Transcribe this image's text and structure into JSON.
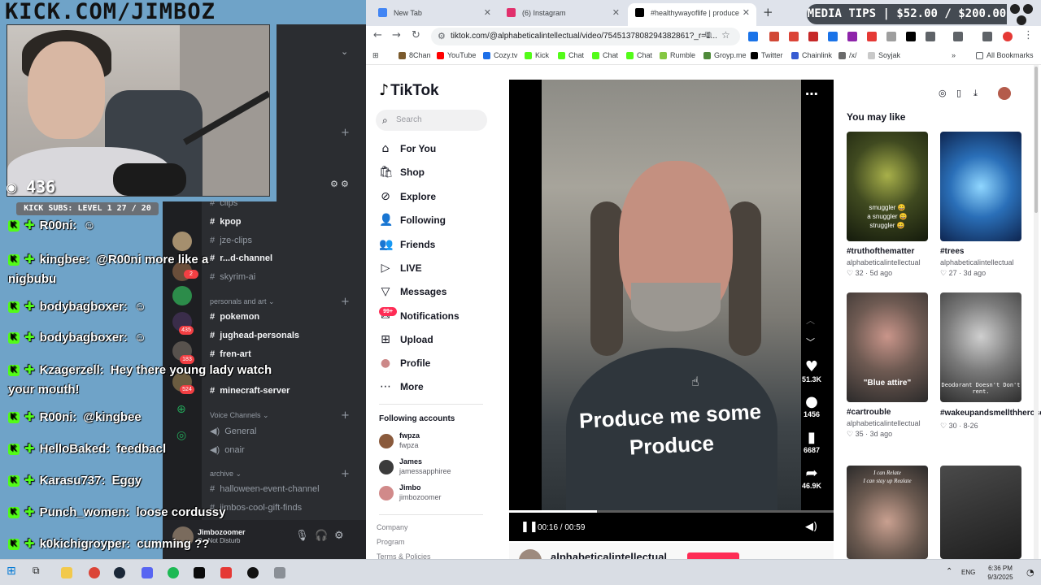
{
  "overlay": {
    "banner": "KICK.COM/JIMBOZ",
    "sub_count": "436",
    "kick_subs": "KICK SUBS: LEVEL 1 27 / 20",
    "chat": [
      {
        "user": "R00ni:",
        "msg": ""
      },
      {
        "user": "kingbee:",
        "msg": "@R00ni more like a nigbubu"
      },
      {
        "user": "bodybagboxer:",
        "msg": ""
      },
      {
        "user": "bodybagboxer:",
        "msg": ""
      },
      {
        "user": "Kzagerzell:",
        "msg": "Hey there young lady watch your mouth!"
      },
      {
        "user": "R00ni:",
        "msg": "@kingbee"
      },
      {
        "user": "HelloBaked:",
        "msg": "feedbacl"
      },
      {
        "user": "Karasu737:",
        "msg": "Eggy"
      },
      {
        "user": "Punch_women:",
        "msg": "loose cordussy"
      },
      {
        "user": "k0kichigroyper:",
        "msg": "cumming ??"
      }
    ]
  },
  "discord": {
    "channels": [
      {
        "label": "clips",
        "active": false
      },
      {
        "label": "kpop",
        "active": true
      },
      {
        "label": "jze-clips",
        "active": false
      },
      {
        "label": "r...d-channel",
        "active": true
      },
      {
        "label": "skyrim-ai",
        "active": false
      }
    ],
    "category_personals": "personals and art",
    "personals_channels": [
      {
        "label": "pokemon"
      },
      {
        "label": "jughead-personals"
      },
      {
        "label": "fren-art"
      },
      {
        "label": "minecraft-server"
      }
    ],
    "category_voice": "Voice Channels",
    "voice_channels": [
      "General",
      "onair"
    ],
    "category_archive": "archive",
    "archive_channels": [
      "halloween-event-channel",
      "jimbos-cool-gift-finds"
    ],
    "server_badges": [
      "2",
      "435",
      "183",
      "524"
    ],
    "user": {
      "name": "Jimbozoomer",
      "status": "Do Not Disturb"
    }
  },
  "browser": {
    "tabs": [
      {
        "title": "New Tab",
        "fav_color": "#4285f4"
      },
      {
        "title": "(6) Instagram",
        "fav_color": "#e1306c"
      },
      {
        "title": "#healthywayoflife | produce",
        "fav_color": "#000000"
      }
    ],
    "media_tips": "MEDIA TIPS | $52.00 / $200.00",
    "url": "tiktok.com/@alphabeticalintellectual/video/7545137808294382861?_r=1...",
    "bookmarks": [
      {
        "label": "8Chan",
        "color": "#7a5a2c"
      },
      {
        "label": "YouTube",
        "color": "#ff0000"
      },
      {
        "label": "Cozy.tv",
        "color": "#1d6fe8"
      },
      {
        "label": "Kick",
        "color": "#53fc18"
      },
      {
        "label": "Chat",
        "color": "#53fc18"
      },
      {
        "label": "Chat",
        "color": "#53fc18"
      },
      {
        "label": "Chat",
        "color": "#53fc18"
      },
      {
        "label": "Rumble",
        "color": "#85c742"
      },
      {
        "label": "Groyp.me",
        "color": "#4f8a3a"
      },
      {
        "label": "Twitter",
        "color": "#000000"
      },
      {
        "label": "Chainlink",
        "color": "#375bd2"
      },
      {
        "label": "/x/",
        "color": "#6b6b6b"
      },
      {
        "label": "Soyjak",
        "color": "#c9c9c9"
      }
    ],
    "all_bookmarks": "All Bookmarks"
  },
  "tiktok": {
    "logo": "TikTok",
    "search_placeholder": "Search",
    "nav": [
      {
        "label": "For You",
        "icon": "⌂"
      },
      {
        "label": "Shop",
        "icon": "🛍"
      },
      {
        "label": "Explore",
        "icon": "⊘"
      },
      {
        "label": "Following",
        "icon": "👤"
      },
      {
        "label": "Friends",
        "icon": "👥"
      },
      {
        "label": "LIVE",
        "icon": "▷"
      },
      {
        "label": "Messages",
        "icon": "▽"
      },
      {
        "label": "Notifications",
        "icon": "✉"
      },
      {
        "label": "Upload",
        "icon": "⊞"
      },
      {
        "label": "Profile",
        "icon": "●"
      },
      {
        "label": "More",
        "icon": "⋯"
      }
    ],
    "notif_badge": "99+",
    "following_title": "Following accounts",
    "following": [
      {
        "name": "fwpza",
        "handle": "fwpza",
        "color": "#8a5a3c"
      },
      {
        "name": "James",
        "handle": "jamessapphiree",
        "color": "#3b3b3b"
      },
      {
        "name": "Jimbo",
        "handle": "jimbozoomer",
        "color": "#d18a8a"
      }
    ],
    "footer": [
      "Company",
      "Program",
      "Terms & Policies"
    ],
    "video": {
      "caption": "Produce me some Produce",
      "likes": "51.3K",
      "comments": "1456",
      "saves": "6687",
      "shares": "46.9K",
      "time": "00:16 / 00:59",
      "progress": 0.27
    },
    "author": "alphabeticalintellectual",
    "you_may_like": "You may like",
    "cards": [
      {
        "tag": "#truthofthematter",
        "author": "alphabeticalintellectual",
        "likes": "32",
        "age": "5d ago",
        "thumb_text": "smuggler 😀\na snuggler 😀\nstruggler 😀",
        "bg": "#2d3a1e"
      },
      {
        "tag": "#trees",
        "author": "alphabeticalintellectual",
        "likes": "27",
        "age": "3d ago",
        "thumb_text": "",
        "bg": "#1f5d9e"
      },
      {
        "tag": "#cartrouble",
        "author": "alphabeticalintellectual",
        "likes": "35",
        "age": "3d ago",
        "thumb_text": "\"Blue attire\"",
        "bg": "#5b4a3f"
      },
      {
        "tag": "#wakeupandsmellthheroses",
        "author": "",
        "likes": "30",
        "age": "8-26",
        "thumb_text": "Deodorant Doesn't Don't rent.",
        "bg": "#6e6e6e"
      },
      {
        "tag": "",
        "author": "",
        "likes": "",
        "age": "",
        "thumb_text": "I can Relate\nI can stay up Realate",
        "bg": "#3e3a38"
      },
      {
        "tag": "",
        "author": "",
        "likes": "",
        "age": "",
        "thumb_text": "",
        "bg": "#2a2a2a"
      }
    ]
  },
  "taskbar": {
    "lang": "ENG",
    "time": "6:36 PM",
    "date": "9/3/2025"
  }
}
